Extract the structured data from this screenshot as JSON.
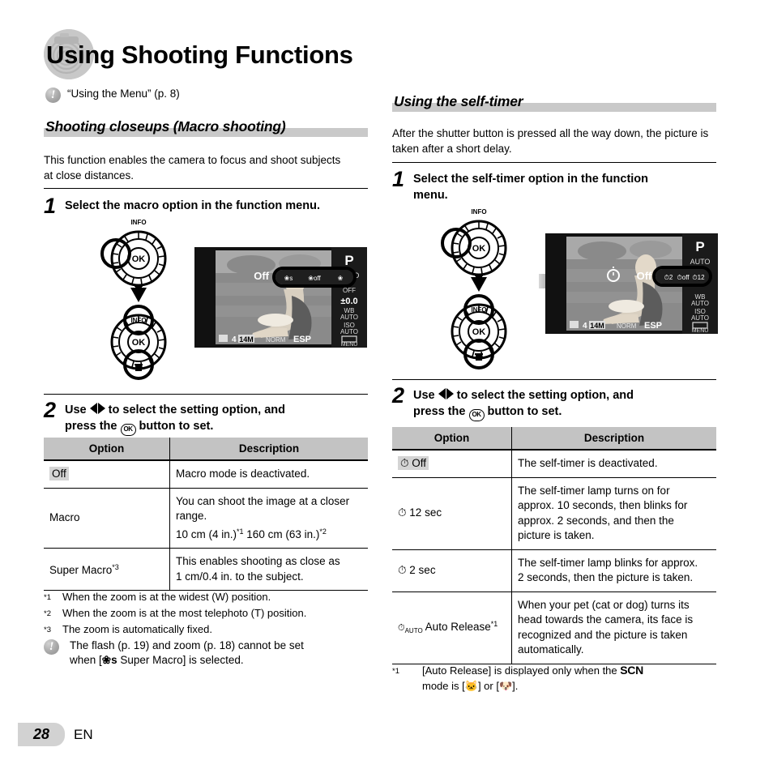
{
  "page": {
    "title": "Using Shooting Functions",
    "number": "28",
    "language": "EN",
    "watermark_icon": "camera-lens-watermark-icon"
  },
  "top_note": {
    "icon": "exclamation-note-icon",
    "text": "“Using the Menu” (p. 8)"
  },
  "left_column": {
    "section_heading": "Shooting closeups (Macro shooting)",
    "intro": "This function enables the camera to focus and shoot subjects at close distances.",
    "step1": {
      "number": "1",
      "text": "Select the macro option in the function menu."
    },
    "illustration": {
      "dial_top_label": "INFO",
      "dial_ok_label": "OK",
      "dial_bottom_label": "trash-icon",
      "down_arrow_icon": "down-arrow-icon",
      "right_arrow_icon": "right-arrow-icon",
      "lcd": {
        "mode": "P",
        "menu_label": "Off",
        "flash_value": "AUTO",
        "exposure": "±0.0",
        "wb_label": "WB",
        "wb_value": "AUTO",
        "iso_label": "ISO",
        "iso_value": "AUTO",
        "flash_off": "OFF",
        "menu_button": "MENU",
        "card_icon": "sd-card-icon",
        "shots": "4",
        "size": "14M",
        "quality": "NORM",
        "metering": "ESP",
        "selected_icons": [
          "macro-super-icon",
          "macro-off-icon",
          "macro-icon"
        ]
      }
    },
    "step2": {
      "number": "2",
      "line1_prefix": "Use",
      "line1_mid": "to select the setting option, and",
      "line2_prefix": "press the",
      "line2_suffix": "button to set.",
      "ok_label": "OK"
    },
    "table": {
      "headers": [
        "Option",
        "Description"
      ],
      "rows": [
        {
          "option": "Off",
          "option_highlighted": true,
          "description": "Macro mode is deactivated."
        },
        {
          "option": "Macro",
          "option_highlighted": false,
          "description_lines": [
            "You can shoot the image at a closer range.",
            "10 cm (4 in.)*1 160 cm (63 in.)*2"
          ]
        },
        {
          "option": "Super Macro*3",
          "option_highlighted": false,
          "description_lines": [
            "This enables shooting as close as",
            "1 cm/0.4 in. to the subject."
          ]
        }
      ]
    },
    "footnotes": [
      {
        "mark": "*1",
        "text": "When the zoom is at the widest (W) position."
      },
      {
        "mark": "*2",
        "text": "When the zoom is at the most telephoto (T) position."
      },
      {
        "mark": "*3",
        "text": "The zoom is automatically fixed."
      }
    ],
    "bottom_note": {
      "icon": "exclamation-note-icon",
      "line1": "The flash (p. 19) and zoom (p. 18) cannot be set",
      "line2_before": "when [",
      "line2_icon": "super-macro-icon",
      "line2_after": " Super Macro] is selected."
    }
  },
  "right_column": {
    "section_heading": "Using the self-timer",
    "intro": "After the shutter button is pressed all the way down, the picture is taken after a short delay.",
    "step1": {
      "number": "1",
      "line1": "Select the self-timer option in the function",
      "line2": "menu."
    },
    "illustration": {
      "dial_top_label": "INFO",
      "dial_ok_label": "OK",
      "down_arrow_icon": "down-arrow-icon",
      "right_arrow_icon": "right-arrow-icon",
      "lcd": {
        "mode": "P",
        "menu_label": "Off",
        "flash_value": "AUTO",
        "wb_label": "WB",
        "wb_value": "AUTO",
        "iso_label": "ISO",
        "iso_value": "AUTO",
        "menu_button": "MENU",
        "shots": "4",
        "size": "14M",
        "quality": "NORM",
        "metering": "ESP",
        "selected_icons": [
          "selftimer-2sec-icon",
          "selftimer-off-icon",
          "selftimer-12sec-icon"
        ]
      }
    },
    "step2": {
      "number": "2",
      "line1_prefix": "Use",
      "line1_mid": "to select the setting option, and",
      "line2_prefix": "press the",
      "line2_suffix": "button to set.",
      "ok_label": "OK"
    },
    "table": {
      "headers": [
        "Option",
        "Description"
      ],
      "rows": [
        {
          "icon": "selftimer-icon",
          "option": "Off",
          "option_highlighted": true,
          "description_lines": [
            "The self-timer is deactivated."
          ]
        },
        {
          "icon": "selftimer-icon",
          "option": "12 sec",
          "option_highlighted": false,
          "description_lines": [
            "The self-timer lamp turns on for",
            "approx. 10 seconds, then blinks for",
            "approx. 2 seconds, and then the",
            "picture is taken."
          ]
        },
        {
          "icon": "selftimer-icon",
          "option": "2 sec",
          "option_highlighted": false,
          "description_lines": [
            "The self-timer lamp blinks for approx.",
            "2 seconds, then the picture is taken."
          ]
        },
        {
          "icon": "selftimer-auto-icon",
          "option": "Auto Release*1",
          "option_highlighted": false,
          "description_lines": [
            "When your pet (cat or dog) turns its",
            "head towards the camera, its face is",
            "recognized and the picture is taken",
            "automatically."
          ]
        }
      ]
    },
    "footnote": {
      "mark": "*1",
      "line1_before": "[Auto Release] is displayed only when the ",
      "line1_scn": "SCN",
      "line2_before": "mode is [",
      "line2_icon1": "cat-icon",
      "line2_mid": "] or [",
      "line2_icon2": "dog-icon",
      "line2_after": "]."
    }
  },
  "colors": {
    "heading_bar": "#c9c9c9",
    "table_header": "#c3c3c3",
    "highlight": "#d4d4d4",
    "page_tab": "#d2d2d2",
    "rule": "#000000"
  }
}
